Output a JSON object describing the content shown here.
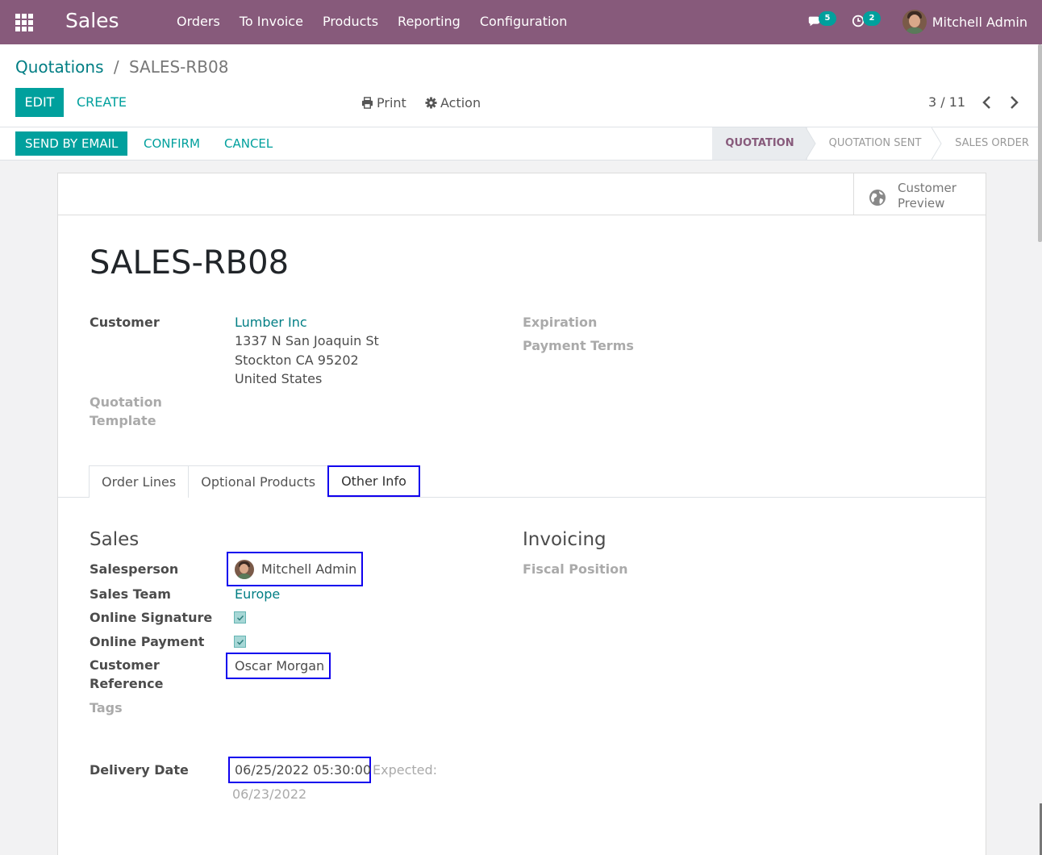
{
  "navbar": {
    "app_title": "Sales",
    "menu": [
      "Orders",
      "To Invoice",
      "Products",
      "Reporting",
      "Configuration"
    ],
    "messages_count": "5",
    "activities_count": "2",
    "user_name": "Mitchell Admin"
  },
  "control_panel": {
    "breadcrumb_parent": "Quotations",
    "breadcrumb_separator": "/",
    "breadcrumb_current": "SALES-RB08",
    "edit_label": "EDIT",
    "create_label": "CREATE",
    "print_label": "Print",
    "action_label": "Action",
    "pager": "3 / 11"
  },
  "statusbar": {
    "send_email_label": "SEND BY EMAIL",
    "confirm_label": "CONFIRM",
    "cancel_label": "CANCEL",
    "stages": [
      "QUOTATION",
      "QUOTATION SENT",
      "SALES ORDER"
    ],
    "active_stage": "QUOTATION"
  },
  "sheet": {
    "customer_preview_line1": "Customer",
    "customer_preview_line2": "Preview",
    "title": "SALES-RB08",
    "customer_label": "Customer",
    "customer_name": "Lumber Inc",
    "address_line1": "1337 N San Joaquin St",
    "address_line2": "Stockton CA 95202",
    "address_line3": "United States",
    "quotation_template_label_1": "Quotation",
    "quotation_template_label_2": "Template",
    "expiration_label": "Expiration",
    "payment_terms_label": "Payment Terms",
    "tabs": [
      "Order Lines",
      "Optional Products",
      "Other Info"
    ],
    "active_tab": "Other Info",
    "sales_section": "Sales",
    "salesperson_label": "Salesperson",
    "salesperson_value": "Mitchell Admin",
    "sales_team_label": "Sales Team",
    "sales_team_value": "Europe",
    "online_signature_label": "Online Signature",
    "online_signature_checked": true,
    "online_payment_label": "Online Payment",
    "online_payment_checked": true,
    "customer_reference_label_1": "Customer",
    "customer_reference_label_2": "Reference",
    "customer_reference_value": "Oscar Morgan",
    "tags_label": "Tags",
    "delivery_date_label": "Delivery Date",
    "delivery_date_value": "06/25/2022 05:30:00",
    "expected_label": "Expected:",
    "expected_value": "06/23/2022",
    "invoicing_section": "Invoicing",
    "fiscal_position_label": "Fiscal Position"
  },
  "colors": {
    "navbar": "#875a7b",
    "primary": "#00a09d",
    "link": "#017e84",
    "highlight": "#1000ee"
  }
}
